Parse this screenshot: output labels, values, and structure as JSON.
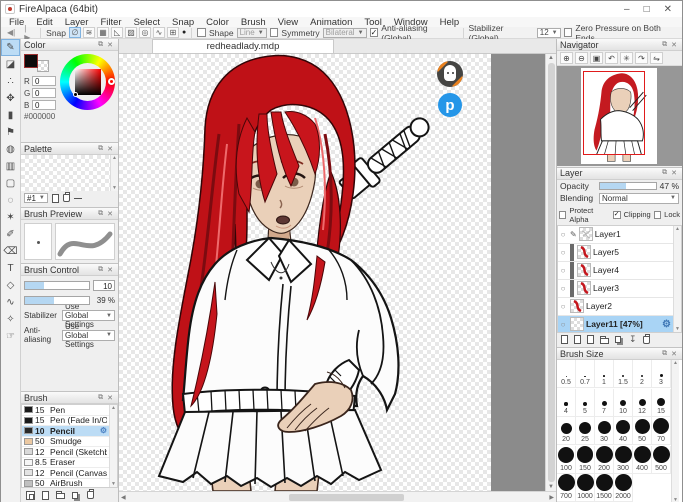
{
  "window": {
    "title": "FireAlpaca (64bit)",
    "minimize": "–",
    "maximize": "□",
    "close": "✕"
  },
  "menu": [
    "File",
    "Edit",
    "Layer",
    "Filter",
    "Select",
    "Snap",
    "Color",
    "Brush",
    "View",
    "Animation",
    "Tool",
    "Window",
    "Help"
  ],
  "toolbar": {
    "undo_glyph": "◀|",
    "redo_glyph": "|▶",
    "snap_label": "Snap",
    "snaps": [
      {
        "name": "snap-off",
        "glyph": "∅",
        "active": true
      },
      {
        "name": "snap-parallel",
        "glyph": "≋",
        "active": false
      },
      {
        "name": "snap-crisscross",
        "glyph": "▦",
        "active": false
      },
      {
        "name": "snap-vanishing-point",
        "glyph": "◺",
        "active": false
      },
      {
        "name": "snap-radial",
        "glyph": "▨",
        "active": false
      },
      {
        "name": "snap-circle",
        "glyph": "◎",
        "active": false
      },
      {
        "name": "snap-curve",
        "glyph": "∿",
        "active": false
      },
      {
        "name": "snap-grid",
        "glyph": "⊞",
        "active": false
      }
    ],
    "snap_dot_glyph": "●",
    "shape": {
      "label": "Shape",
      "checked": false,
      "value": "Line"
    },
    "symmetry": {
      "label": "Symmetry",
      "checked": false,
      "value": "Bilateral"
    },
    "antialias": {
      "label": "Anti-aliasing (Global)",
      "checked": true
    },
    "stabilizer": {
      "label": "Stabilizer (Global)",
      "value": "12"
    },
    "zero_pressure": {
      "label": "Zero Pressure on Both Ends",
      "checked": false
    }
  },
  "tools": [
    {
      "name": "brush-tool",
      "glyph": "✎",
      "active": true
    },
    {
      "name": "eraser-tool",
      "glyph": "◪",
      "active": false
    },
    {
      "name": "dot-tool",
      "glyph": "∴",
      "active": false
    },
    {
      "name": "move-tool",
      "glyph": "✥",
      "active": false
    },
    {
      "name": "fill-tool",
      "glyph": "▮",
      "active": false
    },
    {
      "name": "bucket-tool",
      "glyph": "⚑",
      "active": false
    },
    {
      "name": "paint-bucket-tool",
      "glyph": "◍",
      "active": false
    },
    {
      "name": "gradient-tool",
      "glyph": "▥",
      "active": false
    },
    {
      "name": "select-rect-tool",
      "glyph": "▢",
      "active": false
    },
    {
      "name": "lasso-tool",
      "glyph": "◌",
      "active": false
    },
    {
      "name": "magic-wand-tool",
      "glyph": "✶",
      "active": false
    },
    {
      "name": "select-pen-tool",
      "glyph": "✐",
      "active": false
    },
    {
      "name": "select-eraser-tool",
      "glyph": "⌫",
      "active": false
    },
    {
      "name": "text-tool",
      "glyph": "T",
      "active": false
    },
    {
      "name": "shape-tool",
      "glyph": "◇",
      "active": false
    },
    {
      "name": "curve-tool",
      "glyph": "∿",
      "active": false
    },
    {
      "name": "eyedropper-tool",
      "glyph": "✧",
      "active": false
    },
    {
      "name": "hand-tool",
      "glyph": "☞",
      "active": false
    }
  ],
  "color_panel": {
    "title": "Color",
    "r_label": "R",
    "g_label": "G",
    "b_label": "B",
    "r": "0",
    "g": "0",
    "b": "0",
    "hex": "#000000"
  },
  "palette_panel": {
    "title": "Palette",
    "page": "#1"
  },
  "brush_preview_panel": {
    "title": "Brush Preview"
  },
  "brush_control_panel": {
    "title": "Brush Control",
    "size_value": "10",
    "opacity_value": "39 %",
    "stabilizer_label": "Stabilizer",
    "stabilizer_value": "Use Global Settings",
    "antialias_label": "Anti-aliasing",
    "antialias_value": "Use Global Settings"
  },
  "brush_panel": {
    "title": "Brush",
    "brushes": [
      {
        "size": "15",
        "name": "Pen",
        "swatch": "#1a1a1a",
        "selected": false
      },
      {
        "size": "15",
        "name": "Pen (Fade In/Out)",
        "swatch": "#1a1a1a",
        "selected": false
      },
      {
        "size": "10",
        "name": "Pencil",
        "swatch": "#2a2a2a",
        "selected": true
      },
      {
        "size": "50",
        "name": "Smudge",
        "swatch": "#ecc9a2",
        "selected": false
      },
      {
        "size": "12",
        "name": "Pencil (Sketchbook)",
        "swatch": "#d9d9d9",
        "selected": false
      },
      {
        "size": "8.5",
        "name": "Eraser",
        "swatch": "#f6f6f6",
        "selected": false
      },
      {
        "size": "12",
        "name": "Pencil (Canvas)",
        "swatch": "#e4e4e4",
        "selected": false
      },
      {
        "size": "50",
        "name": "AirBrush",
        "swatch": "#c0c0c0",
        "selected": false
      }
    ],
    "footer_icons": [
      {
        "name": "save-brush-button",
        "icon": "save"
      },
      {
        "name": "add-brush-button",
        "icon": "page"
      },
      {
        "name": "brush-folder-button",
        "icon": "folder"
      },
      {
        "name": "duplicate-brush-button",
        "icon": "dup"
      },
      {
        "name": "delete-brush-button",
        "icon": "trash"
      }
    ]
  },
  "canvas": {
    "tab": "redheadlady.mdp"
  },
  "navigator": {
    "title": "Navigator",
    "buttons": [
      {
        "name": "zoom-in-button",
        "glyph": "⊕"
      },
      {
        "name": "zoom-out-button",
        "glyph": "⊖"
      },
      {
        "name": "zoom-fit-button",
        "glyph": "▣"
      },
      {
        "name": "rotate-left-button",
        "glyph": "↶"
      },
      {
        "name": "rotate-reset-button",
        "glyph": "✳"
      },
      {
        "name": "rotate-right-button",
        "glyph": "↷"
      },
      {
        "name": "flip-button",
        "glyph": "⇋"
      }
    ]
  },
  "layer_panel": {
    "title": "Layer",
    "opacity_label": "Opacity",
    "opacity_value": "47 %",
    "opacity_pct": 47,
    "blending_label": "Blending",
    "blending_value": "Normal",
    "checks": [
      {
        "label": "Protect Alpha",
        "checked": false
      },
      {
        "label": "Clipping",
        "checked": true
      },
      {
        "label": "Lock",
        "checked": false
      }
    ],
    "layers": [
      {
        "name": "Layer1",
        "thumb": "sketch",
        "clipped": false,
        "selected": false,
        "pen": true,
        "gear": false
      },
      {
        "name": "Layer5",
        "thumb": "red",
        "clipped": true,
        "selected": false,
        "pen": false,
        "gear": false
      },
      {
        "name": "Layer4",
        "thumb": "red",
        "clipped": true,
        "selected": false,
        "pen": false,
        "gear": false
      },
      {
        "name": "Layer3",
        "thumb": "red",
        "clipped": true,
        "selected": false,
        "pen": false,
        "gear": false
      },
      {
        "name": "Layer2",
        "thumb": "red",
        "clipped": false,
        "selected": false,
        "pen": false,
        "gear": false
      },
      {
        "name": "Layer11 [47%]",
        "thumb": "checker",
        "clipped": false,
        "selected": true,
        "pen": false,
        "gear": true
      }
    ],
    "footer_icons": [
      {
        "name": "add-layer-button",
        "icon": "page"
      },
      {
        "name": "add-8bit-layer-button",
        "icon": "page"
      },
      {
        "name": "add-1bit-layer-button",
        "icon": "page"
      },
      {
        "name": "add-layer-folder-button",
        "icon": "folder"
      },
      {
        "name": "duplicate-layer-button",
        "icon": "dup"
      },
      {
        "name": "merge-down-button",
        "icon": "down"
      },
      {
        "name": "delete-layer-button",
        "icon": "trash"
      }
    ]
  },
  "brush_size_panel": {
    "title": "Brush Size",
    "sizes": [
      {
        "label": "0.5",
        "d": 1
      },
      {
        "label": "0.7",
        "d": 1.3
      },
      {
        "label": "1",
        "d": 1.6
      },
      {
        "label": "1.5",
        "d": 2
      },
      {
        "label": "2",
        "d": 2.4
      },
      {
        "label": "3",
        "d": 3
      },
      {
        "label": "4",
        "d": 3.5
      },
      {
        "label": "5",
        "d": 4
      },
      {
        "label": "7",
        "d": 5
      },
      {
        "label": "10",
        "d": 6
      },
      {
        "label": "12",
        "d": 7
      },
      {
        "label": "15",
        "d": 8
      },
      {
        "label": "20",
        "d": 11
      },
      {
        "label": "25",
        "d": 12
      },
      {
        "label": "30",
        "d": 13
      },
      {
        "label": "40",
        "d": 14
      },
      {
        "label": "50",
        "d": 15
      },
      {
        "label": "70",
        "d": 16
      },
      {
        "label": "100",
        "d": 16
      },
      {
        "label": "150",
        "d": 16.5
      },
      {
        "label": "200",
        "d": 17
      },
      {
        "label": "300",
        "d": 17
      },
      {
        "label": "400",
        "d": 17
      },
      {
        "label": "500",
        "d": 17
      },
      {
        "label": "700",
        "d": 17
      },
      {
        "label": "1000",
        "d": 17
      },
      {
        "label": "1500",
        "d": 17
      },
      {
        "label": "2000",
        "d": 17
      }
    ]
  },
  "colors": {
    "accent_blue": "#bcdcf5",
    "viewport_red": "#e01b1b",
    "hair_red": "#c5161d",
    "skin": "#ead0b9",
    "pixiv_blue": "#2596e8",
    "canvas_dead_gray": "#8b8b8b"
  }
}
